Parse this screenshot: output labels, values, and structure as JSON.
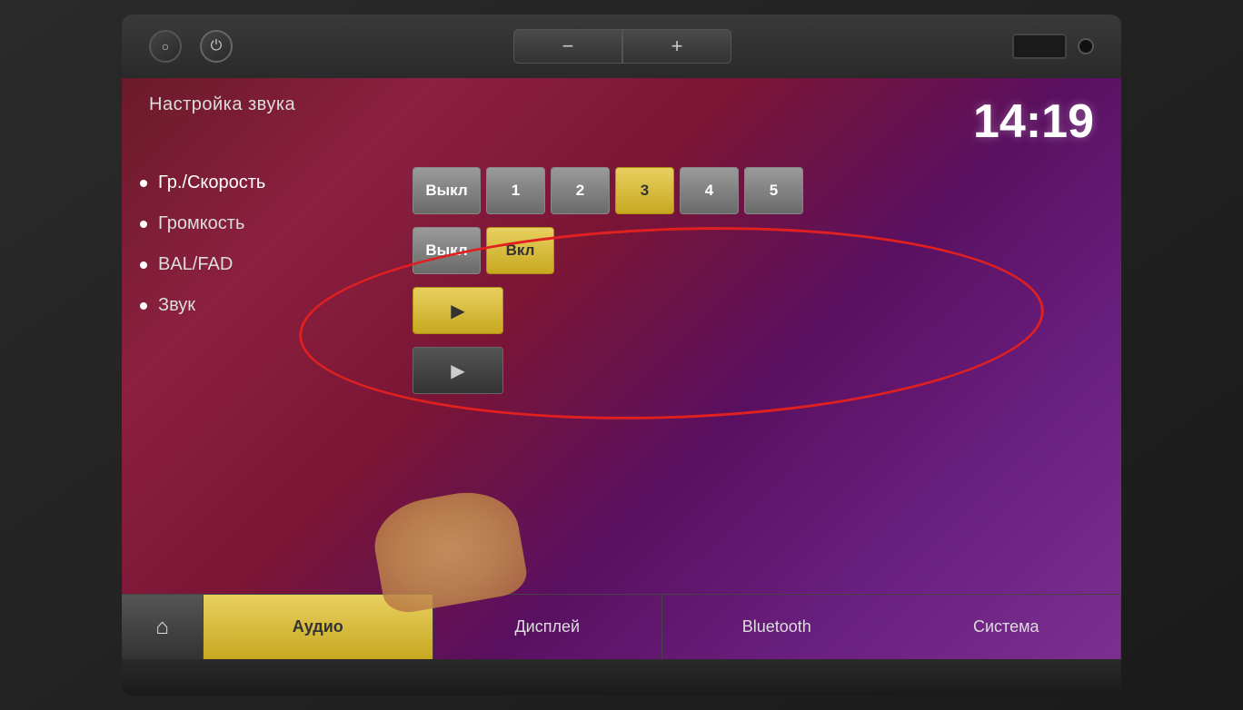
{
  "device": {
    "top_buttons": {
      "circle_btn": "○",
      "power_btn": "⏻",
      "minus_btn": "−",
      "plus_btn": "+"
    }
  },
  "screen": {
    "title": "Настройка звука",
    "time": "14:19",
    "menu": {
      "items": [
        {
          "label": "Гр./Скорость",
          "active": true
        },
        {
          "label": "Громкость",
          "active": false
        },
        {
          "label": "BAL/FAD",
          "active": false
        },
        {
          "label": "Звук",
          "active": false
        }
      ]
    },
    "controls": {
      "speed_row": {
        "buttons": [
          {
            "label": "Выкл",
            "active": false
          },
          {
            "label": "1",
            "active": false
          },
          {
            "label": "2",
            "active": false
          },
          {
            "label": "3",
            "active": true
          },
          {
            "label": "4",
            "active": false
          },
          {
            "label": "5",
            "active": false
          }
        ]
      },
      "volume_row": {
        "buttons": [
          {
            "label": "Выкл",
            "active": false
          },
          {
            "label": "Вкл",
            "active": true
          }
        ]
      },
      "play_btn1": "▶",
      "play_btn2": "▶"
    },
    "nav": {
      "home_icon": "⌂",
      "tabs": [
        {
          "label": "Аудио",
          "active": true
        },
        {
          "label": "Дисплей",
          "active": false
        },
        {
          "label": "Bluetooth",
          "active": false
        },
        {
          "label": "Система",
          "active": false
        }
      ]
    }
  }
}
